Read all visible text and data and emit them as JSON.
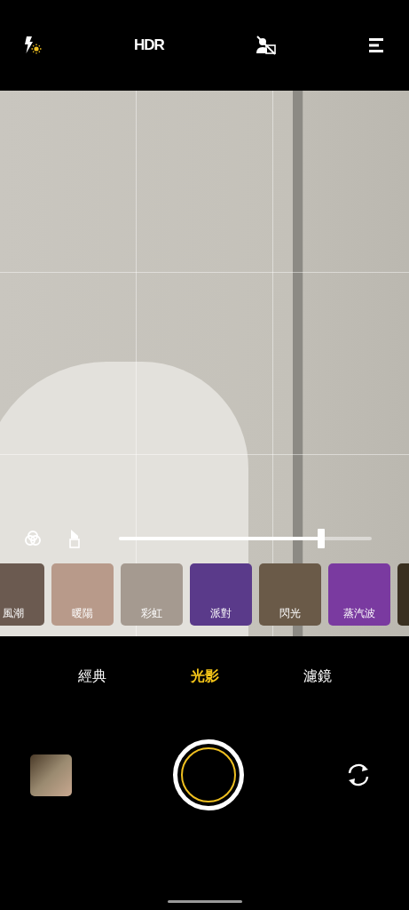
{
  "top_bar": {
    "hdr": "HDR"
  },
  "adjust": {
    "level": 0.8
  },
  "filters": [
    {
      "label": "風潮"
    },
    {
      "label": "暖陽"
    },
    {
      "label": "彩虹"
    },
    {
      "label": "派對"
    },
    {
      "label": "閃光"
    },
    {
      "label": "蒸汽波"
    }
  ],
  "modes": [
    {
      "label": "經典",
      "selected": false
    },
    {
      "label": "光影",
      "selected": true
    },
    {
      "label": "濾鏡",
      "selected": false
    }
  ]
}
